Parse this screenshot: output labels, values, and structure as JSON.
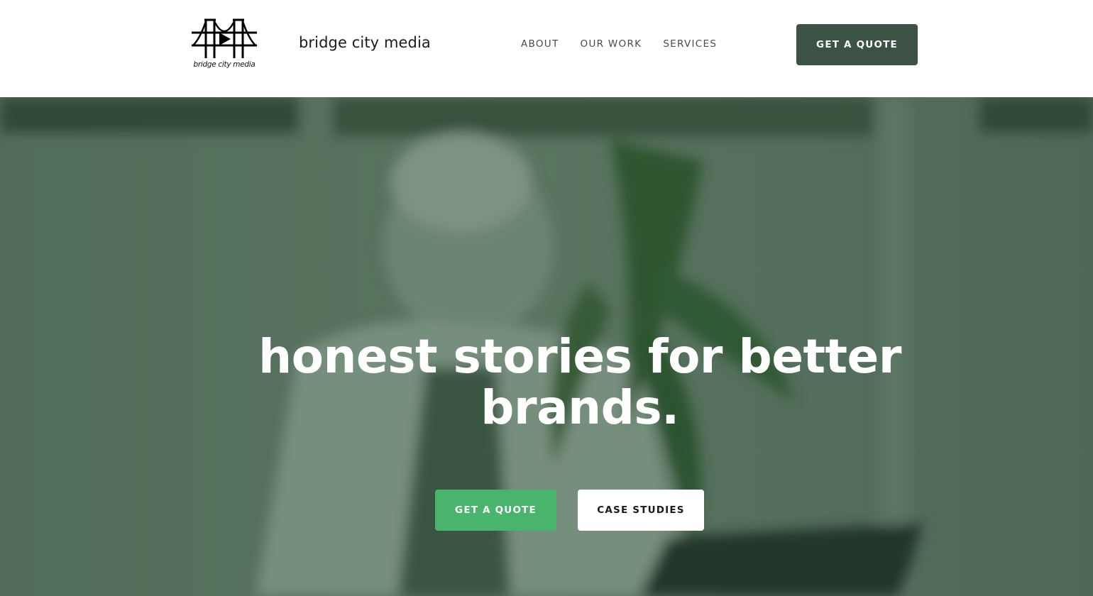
{
  "header": {
    "logo_text": "bridge city media",
    "brand_name": "bridge city media",
    "nav": [
      {
        "label": "ABOUT"
      },
      {
        "label": "OUR WORK"
      },
      {
        "label": "SERVICES"
      }
    ],
    "cta_label": "GET A QUOTE"
  },
  "hero": {
    "title": "honest stories for better brands.",
    "primary_button": "GET A QUOTE",
    "secondary_button": "CASE STUDIES"
  },
  "colors": {
    "header_cta": "#3b5244",
    "primary_button": "#48b46c",
    "hero_tint": "#4f6b57"
  },
  "icons": {
    "logo": "bridge-play-logo"
  }
}
